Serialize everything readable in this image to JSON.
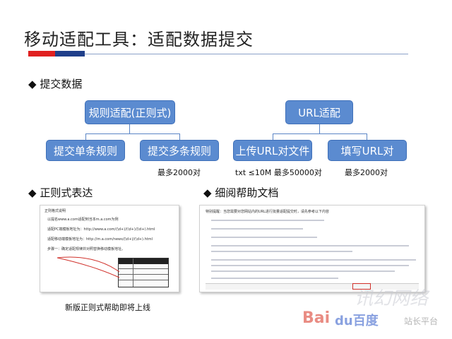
{
  "title": "移动适配工具：适配数据提交",
  "sections": {
    "s1": "提交数据",
    "s2": "正则式表达",
    "s3": "细阅帮助文档"
  },
  "diagram": {
    "left_root": "规则适配(正则式)",
    "left_a": "提交单条规则",
    "left_b": "提交多条规则",
    "left_note": "最多2000对",
    "right_root": "URL适配",
    "right_a": "上传URL对文件",
    "right_b": "填写URL对",
    "right_note_a": "txt  ≤10M 最多50000对",
    "right_note_b": "最多2000对"
  },
  "caption": "新版正则式帮助即将上线",
  "doc_left": {
    "heading": "正则格式说明",
    "lines": [
      "以提名www.a.com适配到当本m.a.com为例",
      "适配PC端模板地址为：http://www.a.com/(\\d+)/(\\d+)/(\\d+).html",
      "适配移动端模板地址为：http://m.a.com/news/(\\d+)/(\\d+).html",
      "步骤一：确定适配规律并对照替换移动模板地址。"
    ]
  },
  "doc_right": {
    "heading": "特别提醒：当您需要对您网站内的URL进行批量适配提交时，请先参考以下内容"
  },
  "watermark": {
    "text1": "讯幻网络",
    "text2": "Bai",
    "text3": "du百度",
    "text4": "站长平台"
  },
  "colors": {
    "accent_red": "#e02020",
    "accent_blue": "#1f3f8a",
    "box_blue": "#5b8bd0"
  }
}
